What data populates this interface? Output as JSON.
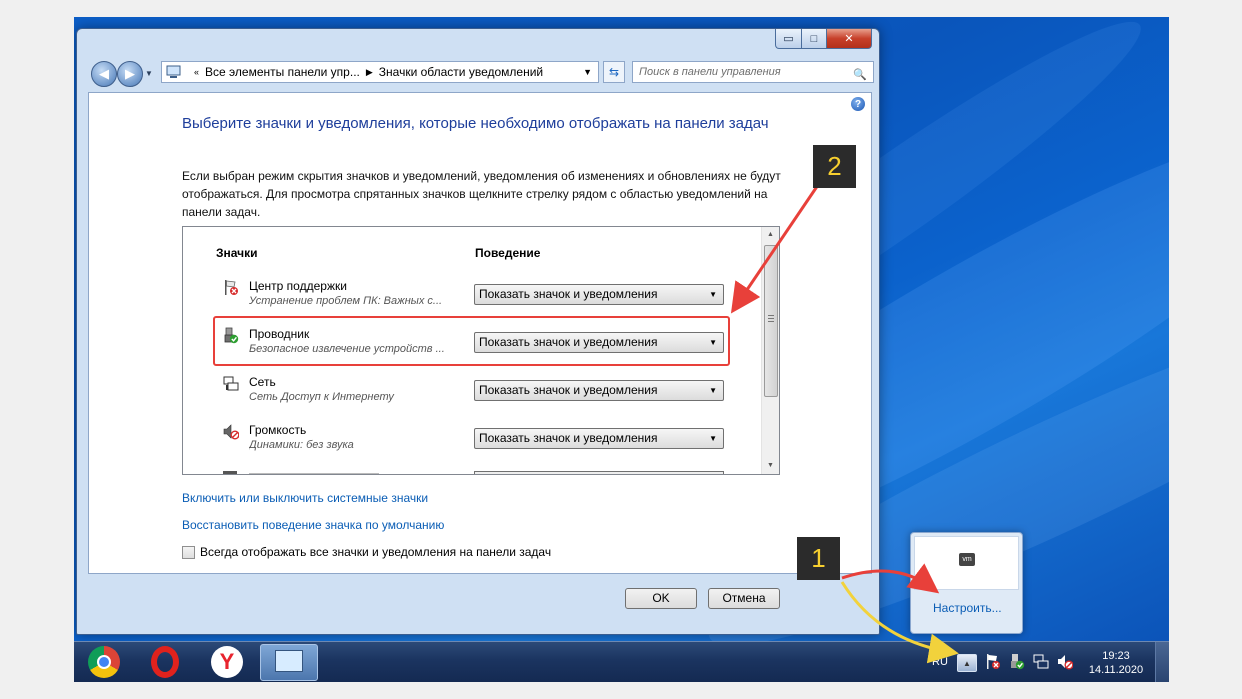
{
  "window": {
    "controls": {
      "minimize": "▭",
      "maximize": "□",
      "close": "✕"
    },
    "address": {
      "crumb_1": "Все элементы панели упр...",
      "crumb_2": "Значки области уведомлений"
    },
    "search_placeholder": "Поиск в панели управления"
  },
  "content": {
    "heading": "Выберите значки и уведомления, которые необходимо отображать на панели задач",
    "description": "Если выбран режим скрытия значков и уведомлений, уведомления об изменениях и обновлениях не будут отображаться. Для просмотра спрятанных значков щелкните стрелку рядом с областью уведомлений на панели задач.",
    "columns": {
      "icons": "Значки",
      "behavior": "Поведение"
    },
    "rows": [
      {
        "name": "Центр поддержки",
        "desc": "Устранение проблем ПК: Важных с...",
        "behavior": "Показать значок и уведомления",
        "icon": "action-center-flag-icon"
      },
      {
        "name": "Проводник",
        "desc": "Безопасное извлечение устройств ...",
        "behavior": "Показать значок и уведомления",
        "icon": "safe-removal-icon"
      },
      {
        "name": "Сеть",
        "desc": "Сеть Доступ к Интернету",
        "behavior": "Показать значок и уведомления",
        "icon": "network-icon"
      },
      {
        "name": "Громкость",
        "desc": "Динамики: без звука",
        "behavior": "Показать значок и уведомления",
        "icon": "volume-muted-icon"
      }
    ],
    "link_system_icons": "Включить или выключить системные значки",
    "link_restore": "Восстановить поведение значка по умолчанию",
    "always_show_label": "Всегда отображать все значки и уведомления на панели задач",
    "ok": "OK",
    "cancel": "Отмена"
  },
  "taskbar": {
    "apps": [
      "chrome-icon",
      "opera-icon",
      "yandex-browser-icon",
      "control-panel-icon"
    ],
    "yandex_letter": "Y",
    "lang": "RU",
    "time": "19:23",
    "date": "14.11.2020"
  },
  "tray_popup": {
    "customize": "Настроить...",
    "vm_label": "vm"
  },
  "annotations": {
    "badge_1": "1",
    "badge_2": "2"
  },
  "colors": {
    "accent": "#1e3e9b",
    "link": "#0a5db5",
    "highlight": "#e8403a",
    "arrow_yellow": "#f2d23c",
    "badge_bg": "#2b2b2b"
  }
}
